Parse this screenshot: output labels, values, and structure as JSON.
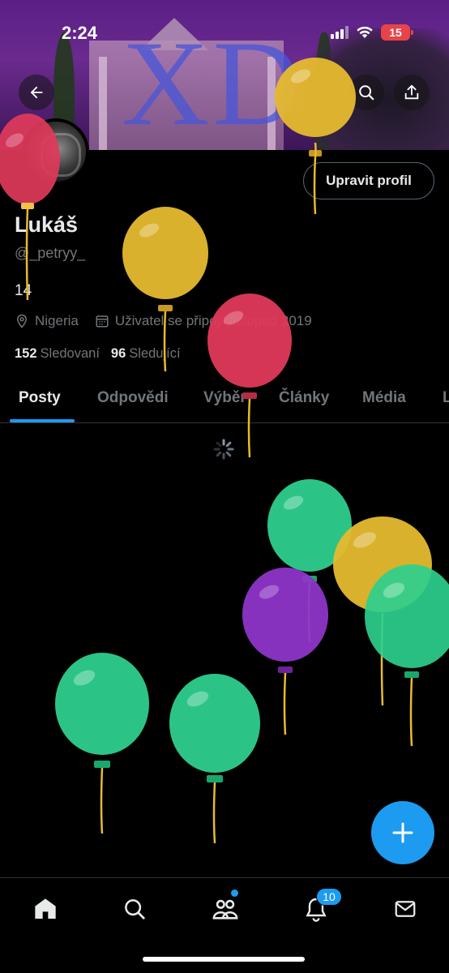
{
  "status": {
    "time": "2:24",
    "battery": "15"
  },
  "banner": {
    "watermark": "XD"
  },
  "header": {
    "back_icon": "arrow-left-icon",
    "search_icon": "search-icon",
    "share_icon": "share-icon",
    "edit_profile": "Upravit profil"
  },
  "profile": {
    "name": "Lukáš",
    "handle": "@_petryy_",
    "bio": "14",
    "location": "Nigeria",
    "joined": "Uživatel se připojil listopad 2019",
    "following_count": "152",
    "following_label": "Sledovaní",
    "followers_count": "96",
    "followers_label": "Sledující"
  },
  "tabs": [
    "Posty",
    "Odpovědi",
    "Výběr",
    "Články",
    "Média",
    "L"
  ],
  "nav": {
    "items": [
      "home-icon",
      "search-icon",
      "communities-icon",
      "notifications-icon",
      "messages-icon"
    ],
    "notifications_badge": "10"
  },
  "colors": {
    "accent": "#1d9bf0",
    "balloon_red": "#e0395a",
    "balloon_yellow": "#e6bb2e",
    "balloon_green": "#2ecf8d",
    "balloon_purple": "#8e35c8"
  }
}
